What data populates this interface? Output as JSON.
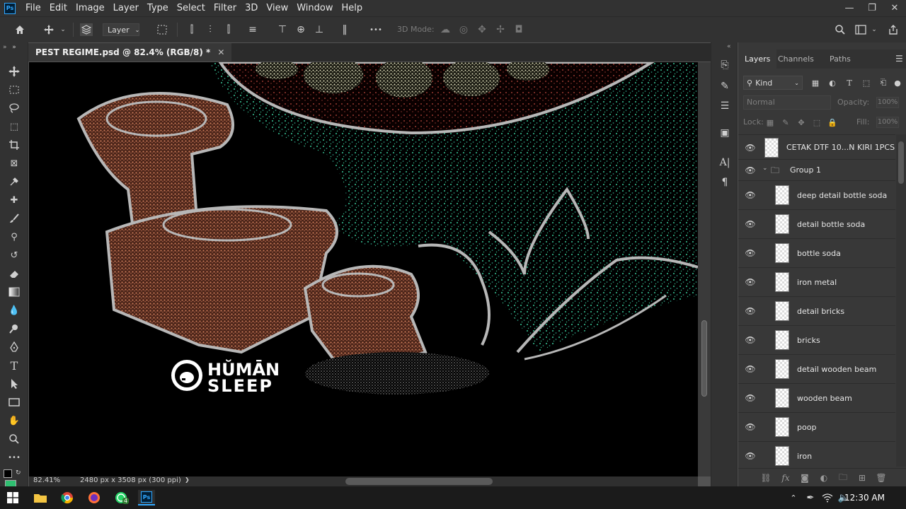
{
  "app": {
    "logo": "Ps"
  },
  "menu": [
    "File",
    "Edit",
    "Image",
    "Layer",
    "Type",
    "Select",
    "Filter",
    "3D",
    "View",
    "Window",
    "Help"
  ],
  "window_controls": {
    "minimize": "—",
    "restore": "❐",
    "close": "✕"
  },
  "options_bar": {
    "auto_select_target": "Layer",
    "mode_3d_label": "3D Mode:",
    "more_label": "•••"
  },
  "document_tab": {
    "title": "PEST REGIME.psd @ 82.4% (RGB/8) *",
    "close": "✕"
  },
  "status_bar": {
    "zoom": "82.41%",
    "doc_info": "2480 px x 3508 px (300 ppi)",
    "arrow": "❯"
  },
  "canvas_art": {
    "logo_line1": "HŬMĀN",
    "logo_line2": "SLEEP"
  },
  "layers_panel": {
    "tabs": [
      "Layers",
      "Channels",
      "Paths"
    ],
    "filter_kind": "Kind",
    "blend_mode": "Normal",
    "opacity_label": "Opacity:",
    "opacity_value": "100%",
    "lock_label": "Lock:",
    "fill_label": "Fill:",
    "fill_value": "100%",
    "layers": [
      {
        "name": "CETAK DTF 10...N KIRI 1PCS",
        "type": "smart"
      },
      {
        "name": "Group 1",
        "type": "group"
      },
      {
        "name": "deep detail bottle soda",
        "type": "layer"
      },
      {
        "name": "detail bottle soda",
        "type": "layer"
      },
      {
        "name": "bottle soda",
        "type": "layer"
      },
      {
        "name": "iron metal",
        "type": "layer"
      },
      {
        "name": "detail bricks",
        "type": "layer"
      },
      {
        "name": "bricks",
        "type": "layer"
      },
      {
        "name": "detail wooden beam",
        "type": "layer"
      },
      {
        "name": "wooden beam",
        "type": "layer"
      },
      {
        "name": "poop",
        "type": "layer"
      },
      {
        "name": "iron",
        "type": "layer"
      }
    ]
  },
  "taskbar": {
    "time": "12:30 AM",
    "whatsapp_badge": "4"
  },
  "colors": {
    "accent": "#31a8ff",
    "canvas": "#000000",
    "panel": "#383838",
    "chrome": "#323232"
  }
}
